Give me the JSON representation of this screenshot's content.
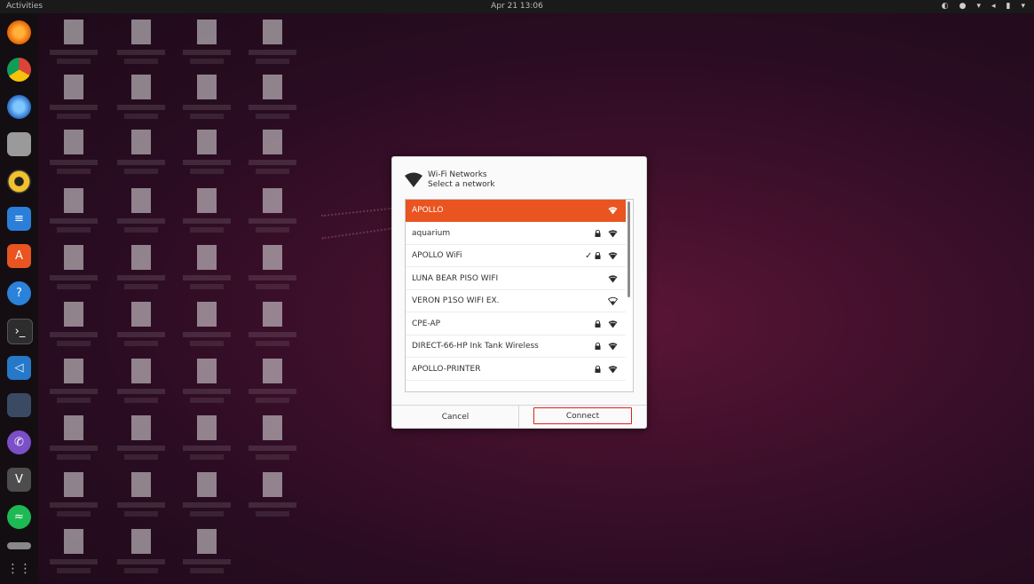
{
  "topbar": {
    "activities": "Activities",
    "clock": "Apr 21  13:06"
  },
  "dialog": {
    "title": "Wi-Fi Networks",
    "subtitle": "Select a network",
    "networks": [
      {
        "name": "APOLLO",
        "selected": true,
        "locked": false,
        "connected": false,
        "signal": "strong"
      },
      {
        "name": "aquarium",
        "selected": false,
        "locked": true,
        "connected": false,
        "signal": "strong"
      },
      {
        "name": "APOLLO WiFi",
        "selected": false,
        "locked": true,
        "connected": true,
        "signal": "strong"
      },
      {
        "name": "LUNA BEAR PISO WIFI",
        "selected": false,
        "locked": false,
        "connected": false,
        "signal": "strong"
      },
      {
        "name": "VERON P1SO WIFI EX.",
        "selected": false,
        "locked": false,
        "connected": false,
        "signal": "weak"
      },
      {
        "name": "CPE-AP",
        "selected": false,
        "locked": true,
        "connected": false,
        "signal": "strong"
      },
      {
        "name": "DIRECT-66-HP Ink Tank Wireless",
        "selected": false,
        "locked": true,
        "connected": false,
        "signal": "strong"
      },
      {
        "name": "APOLLO-PRINTER",
        "selected": false,
        "locked": true,
        "connected": false,
        "signal": "strong"
      }
    ],
    "cancel_label": "Cancel",
    "connect_label": "Connect"
  },
  "colors": {
    "accent": "#e95420",
    "highlight_outline": "#e0201c"
  },
  "dock_icons": [
    "firefox-icon",
    "chrome-icon",
    "thunderbird-icon",
    "files-icon",
    "rhythmbox-icon",
    "writer-icon",
    "software-icon",
    "help-icon",
    "terminal-icon",
    "vscode-icon",
    "display-icon",
    "viber-icon",
    "vim-icon",
    "spotify-icon",
    "drive-icon",
    "show-apps-icon"
  ]
}
